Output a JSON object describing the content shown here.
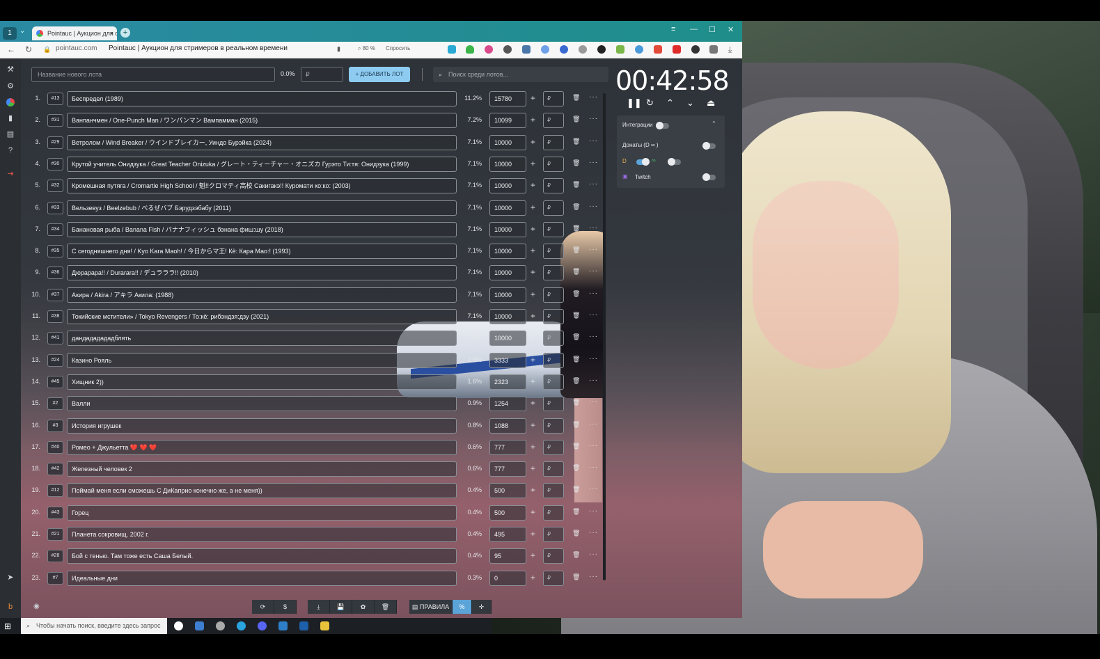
{
  "browser": {
    "tab_title": "Pointauc | Аукцион для с",
    "tab_close": "×",
    "new_tab": "+",
    "workspace": "1",
    "window_controls": [
      "≡",
      "—",
      "☐",
      "✕"
    ],
    "url": "pointauc.com",
    "page_title": "Pointauc | Аукцион для стримеров в реальном времени",
    "zoom": "⌕ 80 %",
    "ask": "Спросить",
    "back": "←",
    "reload": "↻"
  },
  "toolbar": {
    "new_lot_placeholder": "Название нового лота",
    "percent": "0.0%",
    "price_placeholder": "₽",
    "add_label": "+ ДОБАВИТЬ ЛОТ",
    "search_placeholder": "Поиск среди лотов..."
  },
  "lots": [
    {
      "idx": "1.",
      "id": "#13",
      "name": "Беспредел (1989)",
      "pct": "11.2%",
      "amount": "15780"
    },
    {
      "idx": "2.",
      "id": "#31",
      "name": "Ванпанчмен / One-Punch Man / ワンパンマン Вампамман (2015)",
      "pct": "7.2%",
      "amount": "10099"
    },
    {
      "idx": "3.",
      "id": "#29",
      "name": "Ветролом / Wind Breaker / ウインドブレイカー, Уиндо Бурэйкa (2024)",
      "pct": "7.1%",
      "amount": "10000"
    },
    {
      "idx": "4.",
      "id": "#30",
      "name": "Крутой учитель Онидзука / Great Teacher Onizuka / グレート・ティーチャー・オニズカ Гурэто Ти:тя: Онидзука (1999)",
      "pct": "7.1%",
      "amount": "10000"
    },
    {
      "idx": "5.",
      "id": "#32",
      "name": "Кромешная путяга / Cromartie High School / 魁!!クロマティ高校 Сакигакэ!! Куромати ко:ко: (2003)",
      "pct": "7.1%",
      "amount": "10000"
    },
    {
      "idx": "6.",
      "id": "#33",
      "name": "Вельзевуз / Beelzebub / べるぜバブ Бэрудзэбабу (2011)",
      "pct": "7.1%",
      "amount": "10000"
    },
    {
      "idx": "7.",
      "id": "#34",
      "name": "Банановая рыба / Banana Fish / バナナフィッシュ бэнана фиш:шу (2018)",
      "pct": "7.1%",
      "amount": "10000"
    },
    {
      "idx": "8.",
      "id": "#35",
      "name": "С сегодняшнего дня! / Kyo Kara Maoh! / 今日からマ王! Кё: Кара Мао:! (1993)",
      "pct": "7.1%",
      "amount": "10000"
    },
    {
      "idx": "9.",
      "id": "#36",
      "name": "Дюрарара!! / Durarara!! / デュラララ!! (2010)",
      "pct": "7.1%",
      "amount": "10000"
    },
    {
      "idx": "10.",
      "id": "#37",
      "name": "Акира / Akira / アキラ Акила: (1988)",
      "pct": "7.1%",
      "amount": "10000"
    },
    {
      "idx": "11.",
      "id": "#38",
      "name": "Токийские мстители» / Tokyo Revengers / То:кё: рибэндзя:дзу (2021)",
      "pct": "7.1%",
      "amount": "10000"
    },
    {
      "idx": "12.",
      "id": "#41",
      "name": "дандададададблять",
      "pct": "7.1%",
      "amount": "10000"
    },
    {
      "idx": "13.",
      "id": "#24",
      "name": "Казино Рояль",
      "pct": "2.5%",
      "amount": "3333"
    },
    {
      "idx": "14.",
      "id": "#45",
      "name": "Хищник 2))",
      "pct": "1.6%",
      "amount": "2323"
    },
    {
      "idx": "15.",
      "id": "#2",
      "name": "Валли",
      "pct": "0.9%",
      "amount": "1254"
    },
    {
      "idx": "16.",
      "id": "#3",
      "name": "История игрушек",
      "pct": "0.8%",
      "amount": "1088"
    },
    {
      "idx": "17.",
      "id": "#40",
      "name": "Ромео + Джульетта ❤️ ❤️ ❤️",
      "pct": "0.6%",
      "amount": "777"
    },
    {
      "idx": "18.",
      "id": "#42",
      "name": "Железный человек 2",
      "pct": "0.6%",
      "amount": "777"
    },
    {
      "idx": "19.",
      "id": "#12",
      "name": "Поймай меня если сможешь С ДиКаприо конечно же, а не меня))",
      "pct": "0.4%",
      "amount": "500"
    },
    {
      "idx": "20.",
      "id": "#43",
      "name": "Горец",
      "pct": "0.4%",
      "amount": "500"
    },
    {
      "idx": "21.",
      "id": "#21",
      "name": "Планета сокровищ. 2002 г.",
      "pct": "0.4%",
      "amount": "495"
    },
    {
      "idx": "22.",
      "id": "#28",
      "name": "Бой с тенью. Там тоже есть Саша Белый.",
      "pct": "0.4%",
      "amount": "95"
    },
    {
      "idx": "23.",
      "id": "#7",
      "name": "Идеальные дни",
      "pct": "0.3%",
      "amount": "0"
    }
  ],
  "lot_controls": {
    "plus": "+",
    "rub": "₽",
    "trash": "🗑",
    "dots": "···"
  },
  "timer": {
    "value": "00:42:58",
    "controls": [
      "❚❚",
      "↻",
      "⌃",
      "⌄",
      "⏏"
    ]
  },
  "integrations": {
    "title": "Интеграции",
    "collapse": "⌃",
    "donations": "Донаты (D ∞ )",
    "d_label": "D",
    "twitch": "Twitch"
  },
  "bottom": {
    "buttons": [
      "⟳",
      "$",
      "⤓",
      "💾",
      "✿",
      "🗑"
    ],
    "rules": "▤ ПРАВИЛА",
    "percent": "%",
    "move": "✛"
  },
  "taskbar": {
    "search_placeholder": "Чтобы начать поиск, введите здесь запрос"
  }
}
